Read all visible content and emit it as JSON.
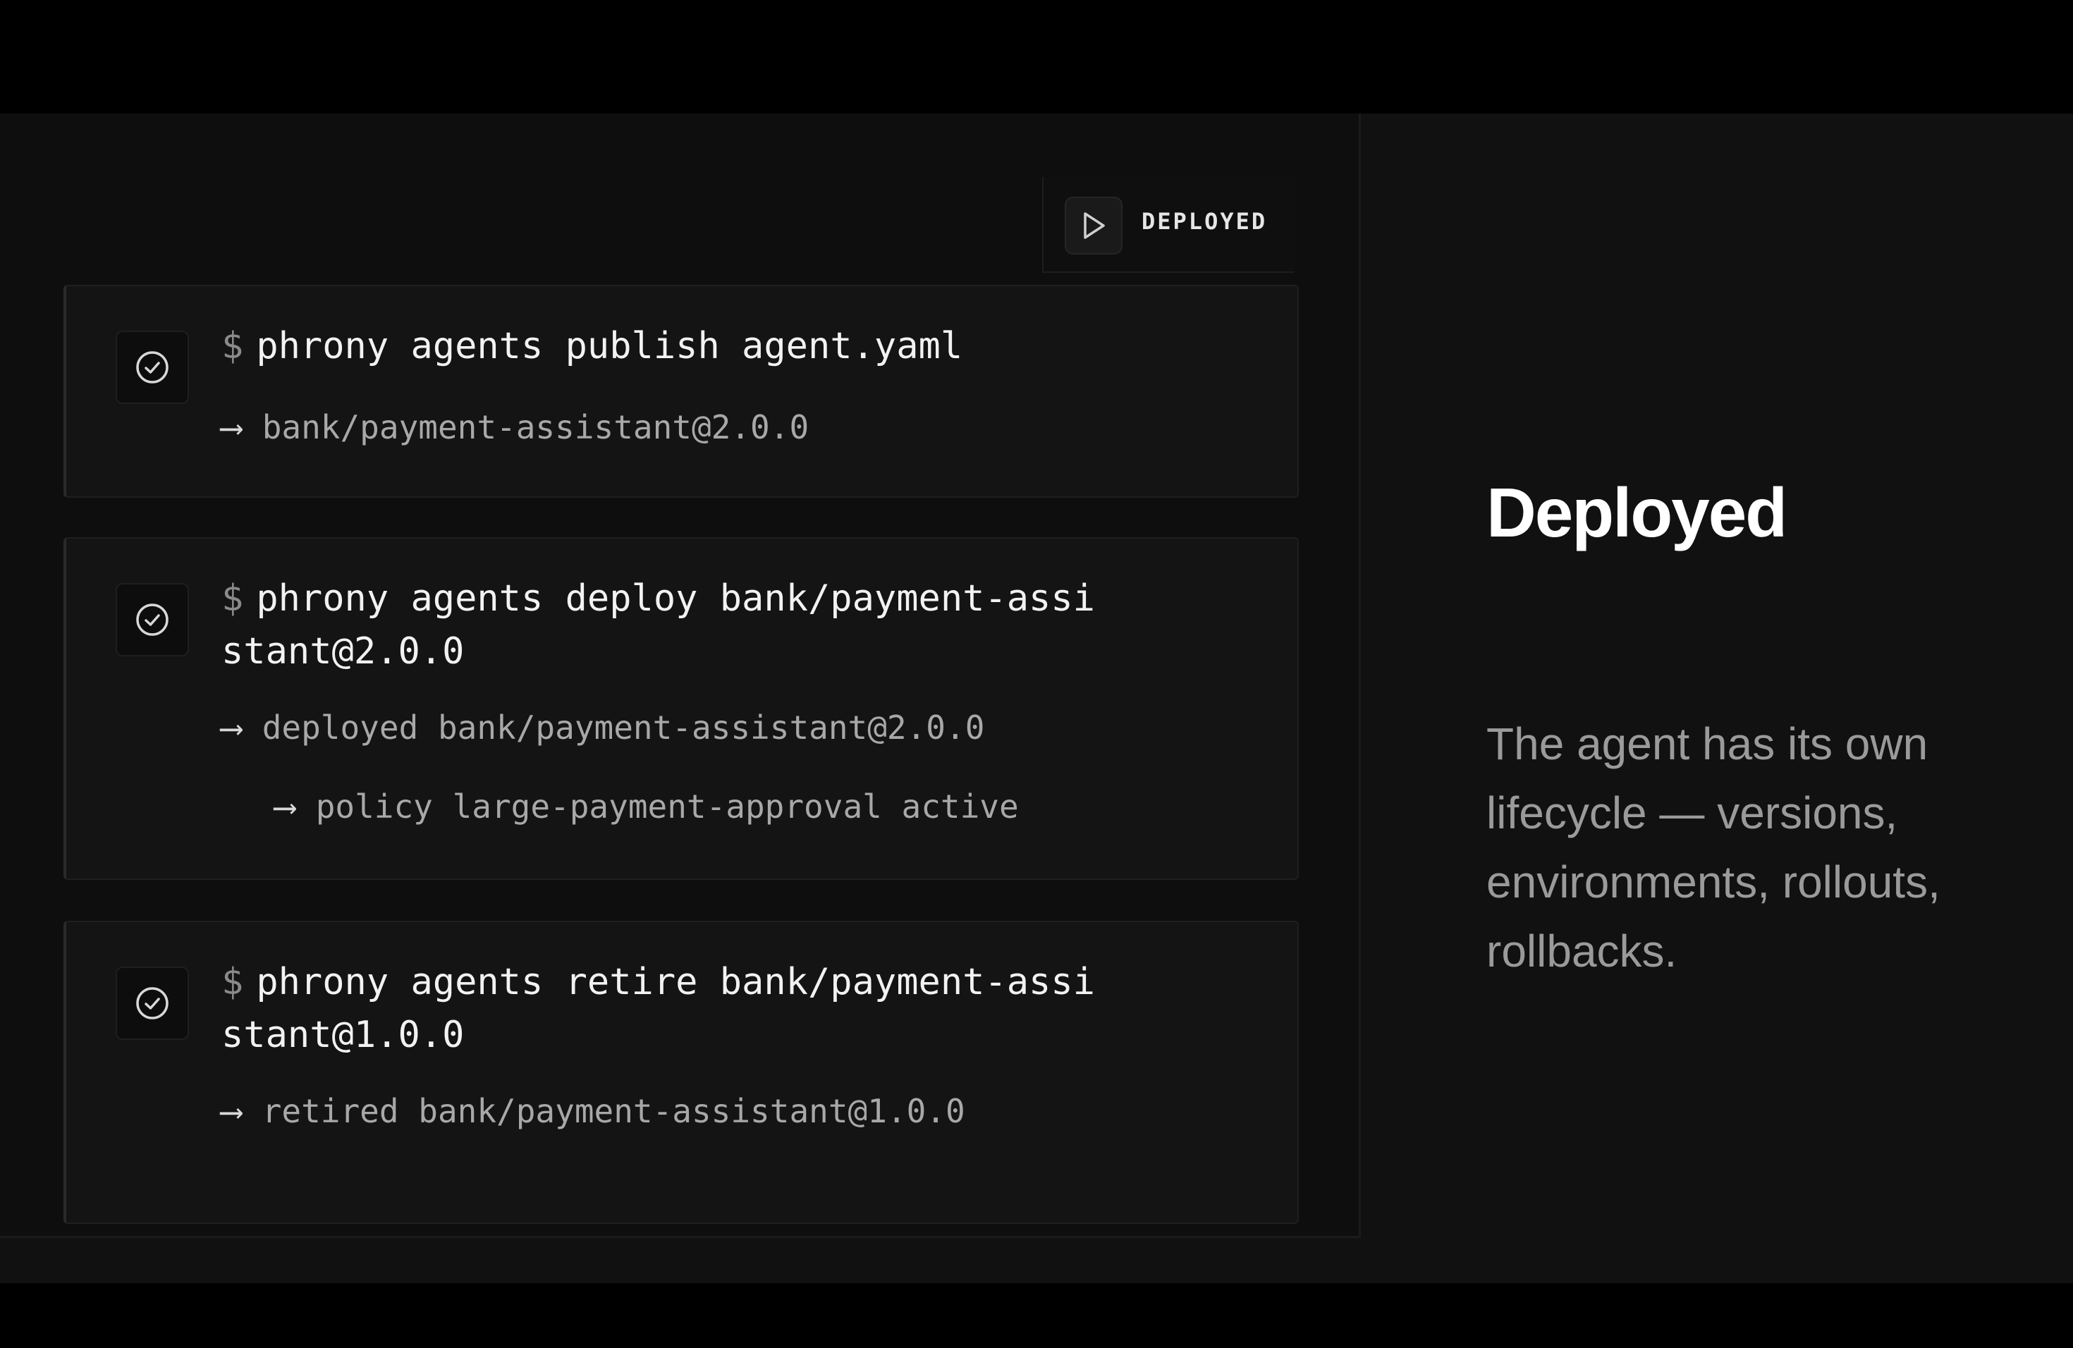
{
  "status": {
    "label": "DEPLOYED",
    "icon": "play-icon"
  },
  "steps": [
    {
      "icon": "check-circle-icon",
      "prompt": "$",
      "command": "phrony agents publish agent.yaml",
      "outputs": [
        {
          "arrow": "⟶",
          "text": "bank/payment-assistant@2.0.0"
        }
      ]
    },
    {
      "icon": "check-circle-icon",
      "prompt": "$",
      "command": "phrony agents deploy bank/payment-assistant@2.0.0",
      "outputs": [
        {
          "arrow": "⟶",
          "text": "deployed bank/payment-assistant@2.0.0"
        },
        {
          "arrow": "⟶",
          "text": "policy large-payment-approval active"
        }
      ]
    },
    {
      "icon": "check-circle-icon",
      "prompt": "$",
      "command": "phrony agents retire bank/payment-assistant@1.0.0",
      "outputs": [
        {
          "arrow": "⟶",
          "text": "retired bank/payment-assistant@1.0.0"
        }
      ]
    }
  ],
  "aside": {
    "title": "Deployed",
    "description": "The agent has its own lifecycle — versions, environments, rollouts, rollbacks."
  }
}
